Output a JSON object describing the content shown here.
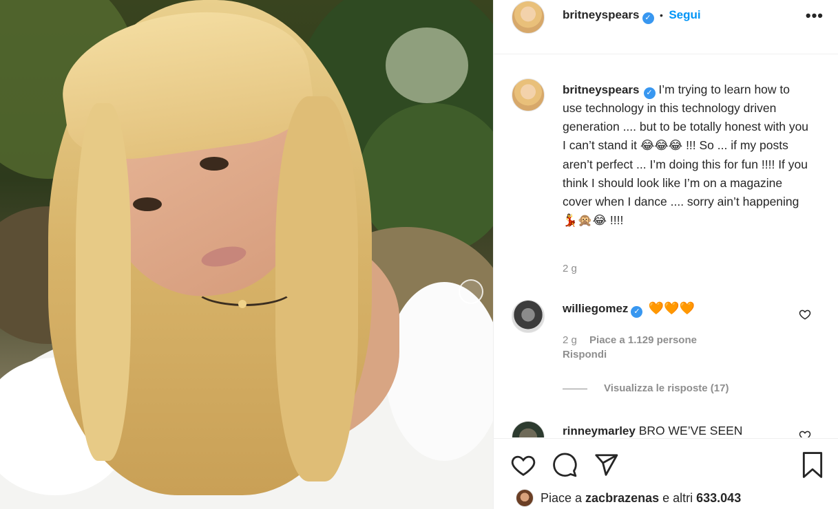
{
  "post_author": {
    "username": "britneyspears",
    "follow_label": "Segui",
    "separator": "•",
    "more_label": "•••"
  },
  "caption": {
    "username": "britneyspears",
    "text_part1": "I’m trying to learn how to use technology in this technology driven generation .... but to be totally honest with you I can’t stand it ",
    "emoji1": "😂😂😂",
    "text_part2": " !!! So ... if my posts aren’t perfect ... I’m doing this for fun !!!! If you think I should look like I’m on a magazine cover when I dance .... sorry ain’t happening ",
    "emoji2": "💃🙊😂",
    "text_part3": " !!!!",
    "time": "2 g"
  },
  "comments": [
    {
      "username": "williegomez",
      "emoji": "🧡🧡🧡",
      "time": "2 g",
      "likes": "Piace a 1.129 persone",
      "reply": "Rispondi",
      "view_replies": "Visualizza le risposte (17)"
    },
    {
      "username": "rinneymarley",
      "text": "BRO WE’VE SEEN"
    }
  ],
  "footer": {
    "likes_prefix": "Piace a ",
    "liker": "zacbrazenas",
    "likes_suffix": " e altri ",
    "likes_count": "633.043"
  },
  "icons": [
    "heart-icon",
    "comment-icon",
    "share-icon",
    "bookmark-icon",
    "verified-icon",
    "more-options-icon"
  ],
  "colors": {
    "link_blue": "#0095f6",
    "verified_blue": "#3897f0",
    "heart_orange": "#f4811f"
  }
}
